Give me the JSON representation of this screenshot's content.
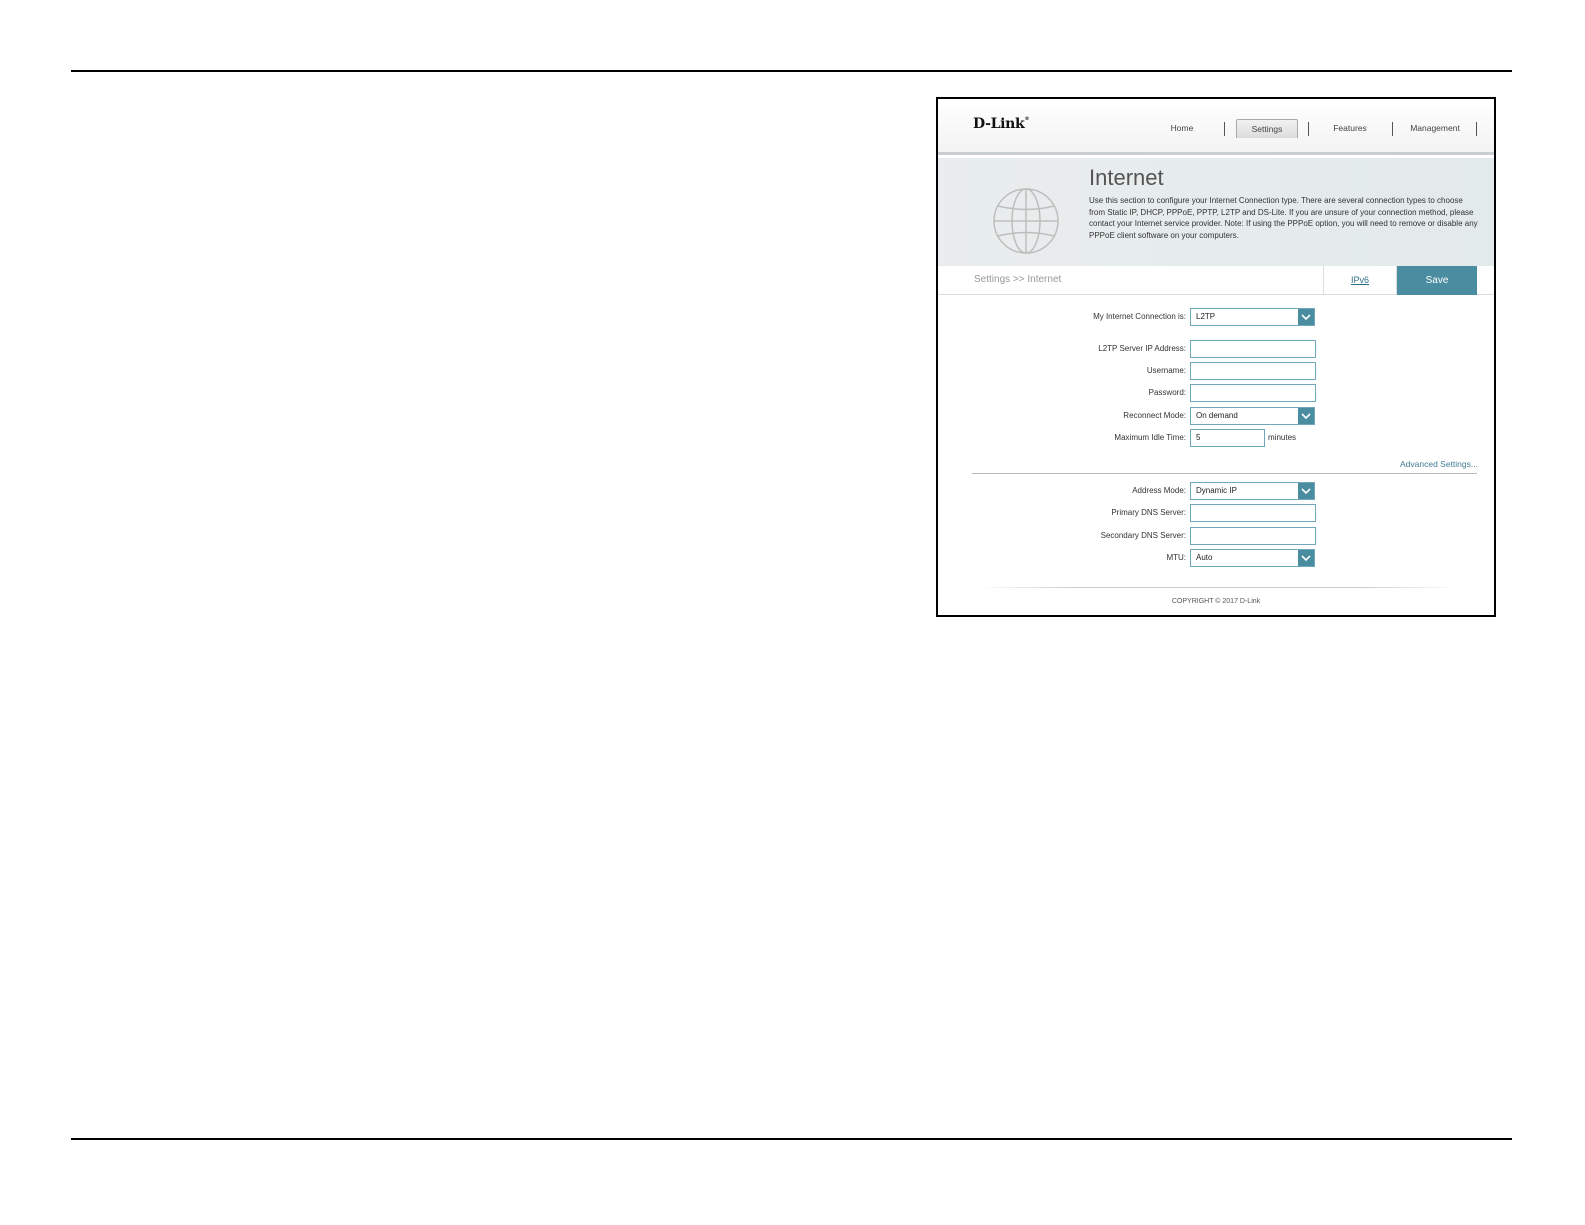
{
  "header": {
    "logo": "D-Link",
    "nav": [
      {
        "label": "Home"
      },
      {
        "label": "Settings",
        "active": true
      },
      {
        "label": "Features"
      },
      {
        "label": "Management"
      }
    ]
  },
  "banner": {
    "title": "Internet",
    "description": "Use this section to configure your Internet Connection type. There are several connection types to choose from Static IP, DHCP, PPPoE, PPTP, L2TP and DS-Lite. If you are unsure of your connection method, please contact your Internet service provider. Note: If using the PPPoE option, you will need to remove or disable any PPPoE client software on your computers.",
    "icon": "globe-icon"
  },
  "toolbar": {
    "breadcrumb": "Settings >> Internet",
    "ipv6_label": "IPv6",
    "save_label": "Save"
  },
  "form": {
    "connection": {
      "label": "My Internet Connection is:",
      "value": "L2TP"
    },
    "server_ip": {
      "label": "L2TP Server IP Address:",
      "value": ""
    },
    "username": {
      "label": "Username:",
      "value": ""
    },
    "password": {
      "label": "Password:",
      "value": ""
    },
    "reconnect": {
      "label": "Reconnect Mode:",
      "value": "On demand"
    },
    "idle_time": {
      "label": "Maximum Idle Time:",
      "value": "5",
      "unit": "minutes"
    },
    "advanced_link": "Advanced Settings...",
    "address_mode": {
      "label": "Address Mode:",
      "value": "Dynamic IP"
    },
    "primary_dns": {
      "label": "Primary DNS Server:",
      "value": ""
    },
    "secondary_dns": {
      "label": "Secondary DNS Server:",
      "value": ""
    },
    "mtu": {
      "label": "MTU:",
      "value": "Auto"
    }
  },
  "footer": {
    "copyright": "COPYRIGHT © 2017 D-Link"
  },
  "colors": {
    "accent": "#4a8da0",
    "link": "#2c6f86"
  }
}
